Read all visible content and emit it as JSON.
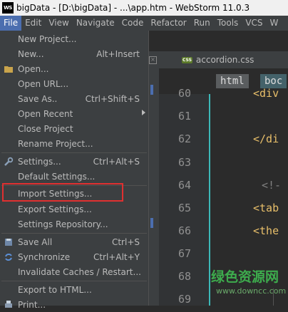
{
  "titlebar": {
    "logo": "WS",
    "title": "bigData - [D:\\bigData] - ...\\app.htm - WebStorm 11.0.3"
  },
  "menubar": [
    {
      "label": "File"
    },
    {
      "label": "Edit"
    },
    {
      "label": "View"
    },
    {
      "label": "Navigate"
    },
    {
      "label": "Code"
    },
    {
      "label": "Refactor"
    },
    {
      "label": "Run"
    },
    {
      "label": "Tools"
    },
    {
      "label": "VCS"
    },
    {
      "label": "W"
    }
  ],
  "menu": {
    "items": [
      {
        "label": "New Project...",
        "shortcut": ""
      },
      {
        "label": "New...",
        "shortcut": "Alt+Insert"
      },
      {
        "label": "Open...",
        "shortcut": ""
      },
      {
        "label": "Open URL...",
        "shortcut": ""
      },
      {
        "label": "Save As..",
        "shortcut": "Ctrl+Shift+S"
      },
      {
        "label": "Open Recent",
        "shortcut": ""
      },
      {
        "label": "Close Project",
        "shortcut": ""
      },
      {
        "label": "Rename Project...",
        "shortcut": ""
      },
      {
        "label": "Settings...",
        "shortcut": "Ctrl+Alt+S"
      },
      {
        "label": "Default Settings...",
        "shortcut": ""
      },
      {
        "label": "Import Settings...",
        "shortcut": ""
      },
      {
        "label": "Export Settings...",
        "shortcut": ""
      },
      {
        "label": "Settings Repository...",
        "shortcut": ""
      },
      {
        "label": "Save All",
        "shortcut": "Ctrl+S"
      },
      {
        "label": "Synchronize",
        "shortcut": "Ctrl+Alt+Y"
      },
      {
        "label": "Invalidate Caches / Restart...",
        "shortcut": ""
      },
      {
        "label": "Export to HTML...",
        "shortcut": ""
      },
      {
        "label": "Print...",
        "shortcut": ""
      }
    ]
  },
  "tabs": {
    "active": "accordion.css",
    "icon": "CSS"
  },
  "breadcrumbs": [
    "html",
    "boc"
  ],
  "editor": {
    "lines": [
      {
        "num": "60",
        "code": "<div"
      },
      {
        "num": "61",
        "code": ""
      },
      {
        "num": "62",
        "code": "</di"
      },
      {
        "num": "63",
        "code": ""
      },
      {
        "num": "64",
        "code": "<!-"
      },
      {
        "num": "65",
        "code": "<tab"
      },
      {
        "num": "66",
        "code": "<the"
      },
      {
        "num": "67",
        "code": ""
      },
      {
        "num": "68",
        "code": ""
      },
      {
        "num": "69",
        "code": ""
      }
    ]
  },
  "watermark": {
    "title": "绿色资源网",
    "url": "www.downcc.com"
  },
  "colors": {
    "accent": "#4b6eaf",
    "highlight_box": "#e03030",
    "gutter_line": "#3cb8b8"
  }
}
